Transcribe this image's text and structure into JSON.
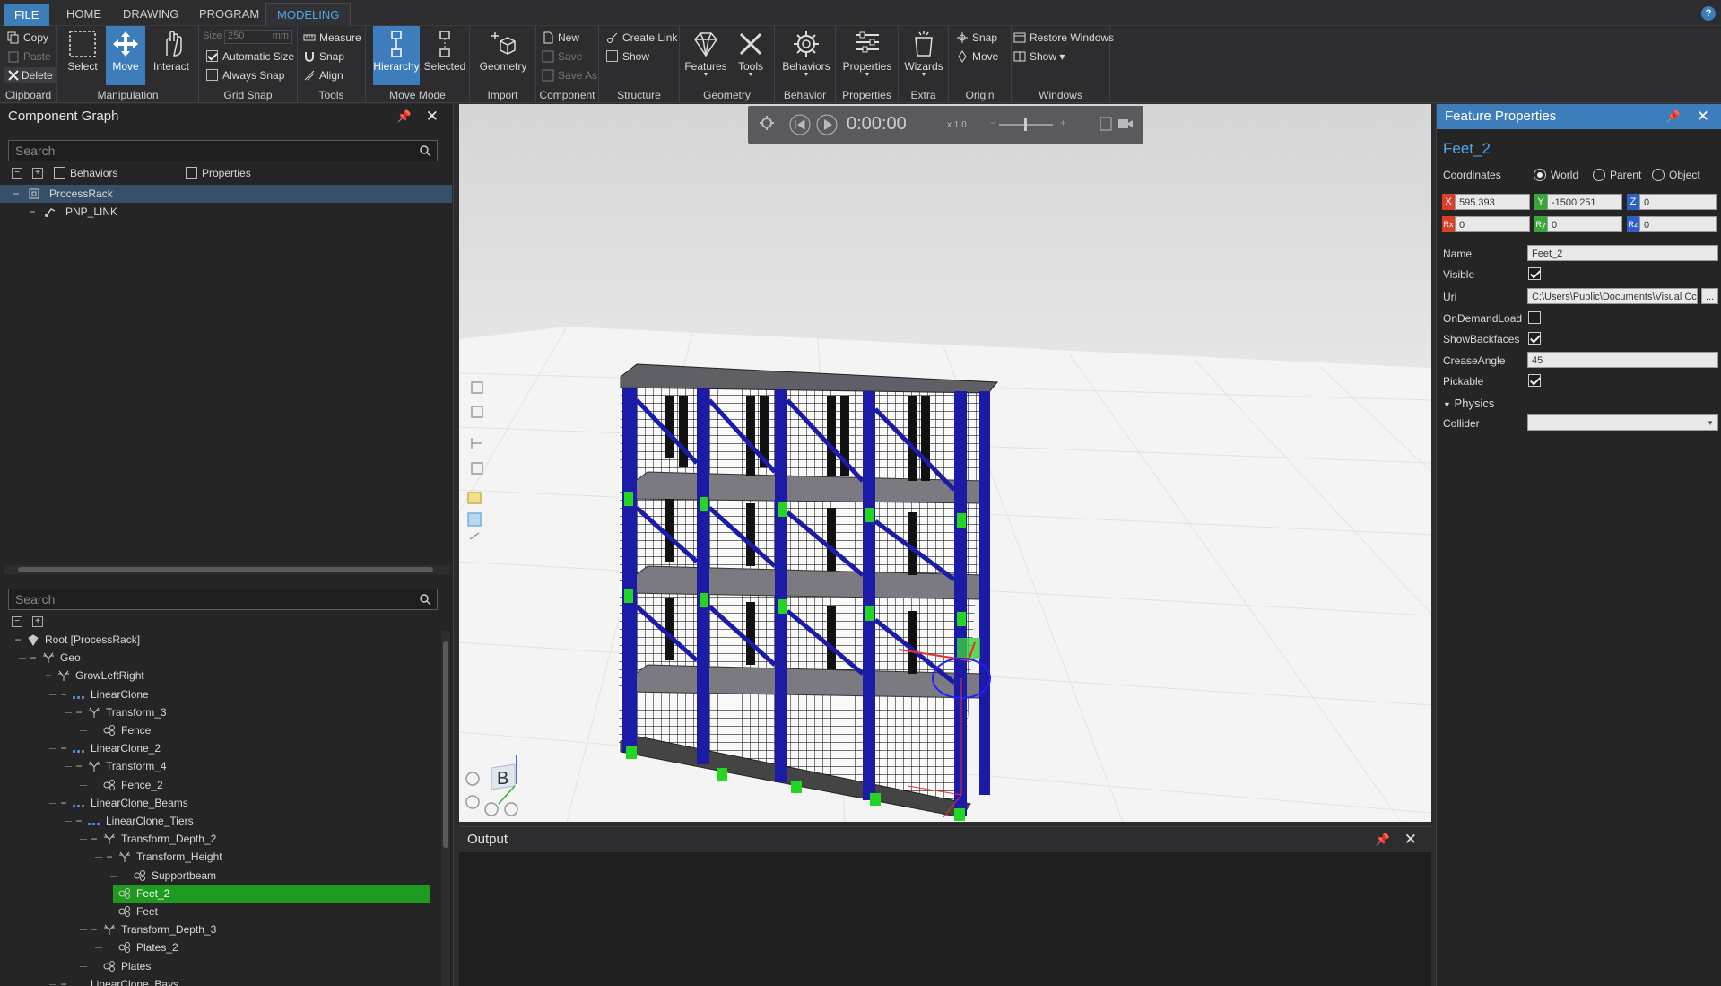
{
  "menu": {
    "tabs": [
      "FILE",
      "HOME",
      "DRAWING",
      "PROGRAM",
      "MODELING"
    ],
    "active_tab": "MODELING",
    "help": "?"
  },
  "ribbon": {
    "clipboard": {
      "label": "Clipboard",
      "copy": "Copy",
      "paste": "Paste",
      "delete": "Delete"
    },
    "manipulation": {
      "label": "Manipulation",
      "select": "Select",
      "move": "Move",
      "interact": "Interact"
    },
    "grid_snap": {
      "label": "Grid Snap",
      "size_label": "Size",
      "size_value": "250",
      "size_unit": "mm",
      "automatic_size": "Automatic Size",
      "always_snap": "Always Snap"
    },
    "tools": {
      "label": "Tools",
      "measure": "Measure",
      "snap": "Snap",
      "align": "Align"
    },
    "move_mode": {
      "label": "Move Mode",
      "hierarchy": "Hierarchy",
      "selected": "Selected"
    },
    "import": {
      "label": "Import",
      "geometry": "Geometry"
    },
    "component": {
      "label": "Component",
      "new": "New",
      "save": "Save",
      "save_as": "Save As"
    },
    "structure": {
      "label": "Structure",
      "create_link": "Create Link",
      "show": "Show"
    },
    "geometry": {
      "label": "Geometry",
      "features": "Features",
      "tools": "Tools"
    },
    "behavior": {
      "label": "Behavior",
      "behaviors": "Behaviors"
    },
    "properties": {
      "label": "Properties",
      "properties": "Properties"
    },
    "extra": {
      "label": "Extra",
      "wizards": "Wizards"
    },
    "origin": {
      "label": "Origin",
      "snap": "Snap",
      "move": "Move"
    },
    "windows": {
      "label": "Windows",
      "restore": "Restore Windows",
      "show": "Show ▾"
    }
  },
  "component_graph": {
    "title": "Component Graph",
    "search_placeholder": "Search",
    "behaviors_label": "Behaviors",
    "properties_label": "Properties",
    "tree": [
      {
        "label": "ProcessRack",
        "level": 0
      },
      {
        "label": "PNP_LINK",
        "level": 1
      }
    ]
  },
  "feature_tree": {
    "search_placeholder": "Search",
    "nodes": [
      {
        "label": "Root [ProcessRack]",
        "indent": 0
      },
      {
        "label": "Geo",
        "indent": 1
      },
      {
        "label": "GrowLeftRight",
        "indent": 2
      },
      {
        "label": "LinearClone",
        "indent": 3
      },
      {
        "label": "Transform_3",
        "indent": 4
      },
      {
        "label": "Fence",
        "indent": 5
      },
      {
        "label": "LinearClone_2",
        "indent": 3
      },
      {
        "label": "Transform_4",
        "indent": 4
      },
      {
        "label": "Fence_2",
        "indent": 5
      },
      {
        "label": "LinearClone_Beams",
        "indent": 3
      },
      {
        "label": "LinearClone_Tiers",
        "indent": 4
      },
      {
        "label": "Transform_Depth_2",
        "indent": 5
      },
      {
        "label": "Transform_Height",
        "indent": 6
      },
      {
        "label": "Supportbeam",
        "indent": 7
      },
      {
        "label": "Feet_2",
        "indent": 6
      },
      {
        "label": "Feet",
        "indent": 6
      },
      {
        "label": "Transform_Depth_3",
        "indent": 5
      },
      {
        "label": "Plates_2",
        "indent": 6
      },
      {
        "label": "Plates",
        "indent": 5
      },
      {
        "label": "LinearClone_Bays",
        "indent": 3
      }
    ]
  },
  "viewport": {
    "time": "0:00:00",
    "speed": "x 1.0",
    "view_letter": "B"
  },
  "output": {
    "title": "Output"
  },
  "feature_properties": {
    "title": "Feature Properties",
    "feature_name": "Feet_2",
    "coordinates_label": "Coordinates",
    "coord_options": [
      "World",
      "Parent",
      "Object"
    ],
    "x": "595.393",
    "y": "-1500.251",
    "z": "0",
    "rx": "0",
    "ry": "0",
    "rz": "0",
    "axis_labels": {
      "x": "X",
      "y": "Y",
      "z": "Z",
      "rx": "Rx",
      "ry": "Ry",
      "rz": "Rz"
    },
    "name_label": "Name",
    "name_value": "Feet_2",
    "visible_label": "Visible",
    "uri_label": "Uri",
    "uri_value": "C:\\Users\\Public\\Documents\\Visual Cc",
    "uri_button": "...",
    "ondemand_label": "OnDemandLoad",
    "showbackfaces_label": "ShowBackfaces",
    "crease_label": "CreaseAngle",
    "crease_value": "45",
    "pickable_label": "Pickable",
    "physics_label": "Physics",
    "collider_label": "Collider",
    "colors": {
      "x": "#d9402a",
      "y": "#3aa63a",
      "z": "#2f5fc8",
      "header": "#3d7dbb"
    }
  }
}
